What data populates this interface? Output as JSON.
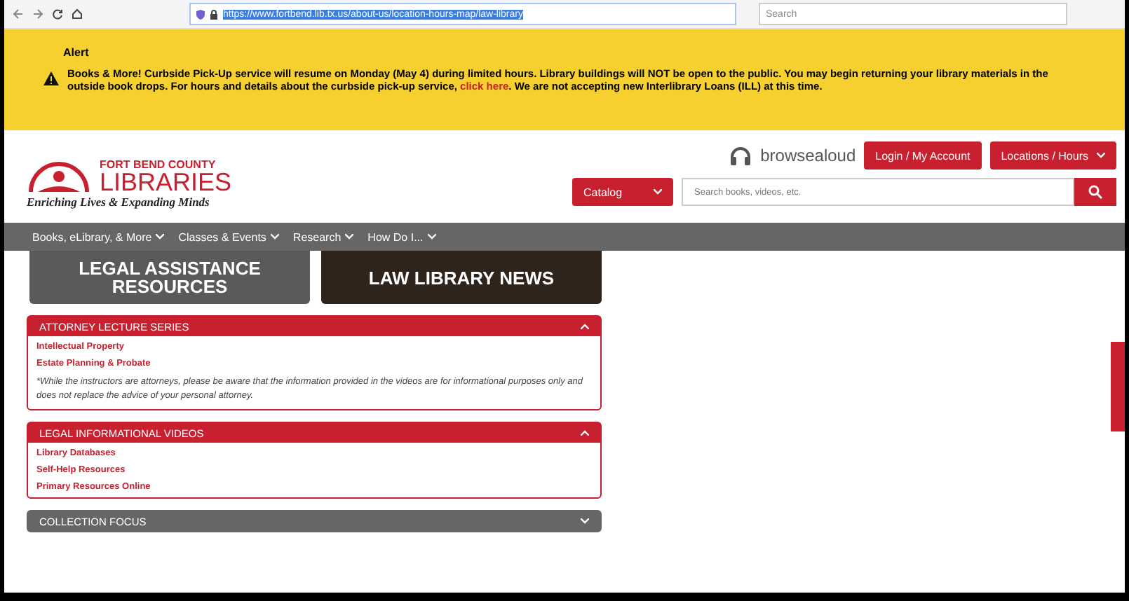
{
  "browser": {
    "url": "https://www.fortbend.lib.tx.us/about-us/location-hours-map/law-library",
    "search_placeholder": "Search"
  },
  "alert": {
    "title": "Alert",
    "text_before": "Books & More! Curbside Pick-Up service will resume on Monday (May 4) during limited hours. Library buildings will NOT be open to the public. You may begin returning your library materials in the outside book drops. For hours and details about the curbside pick-up service, ",
    "link": "click here",
    "text_after": ". We are not accepting new Interlibrary Loans (ILL) at this time."
  },
  "header": {
    "logo_top": "FORT BEND COUNTY",
    "logo_main": "LIBRARIES",
    "tagline": "Enriching Lives & Expanding Minds",
    "browsealoud": "browsealoud",
    "login": "Login / My Account",
    "locations": "Locations / Hours",
    "catalog": "Catalog",
    "search_placeholder": "Search books, videos, etc."
  },
  "nav": [
    {
      "label": "Books, eLibrary, & More"
    },
    {
      "label": "Classes & Events"
    },
    {
      "label": "Research"
    },
    {
      "label": "How Do I..."
    }
  ],
  "tiles": [
    {
      "title": "LEGAL ASSISTANCE RESOURCES"
    },
    {
      "title": "LAW LIBRARY NEWS"
    }
  ],
  "sections": [
    {
      "title": "ATTORNEY LECTURE SERIES",
      "expanded": true,
      "links": [
        "Intellectual Property",
        "Estate Planning & Probate"
      ],
      "note": "*While the instructors are attorneys, please be aware that the information provided in the videos are for informational purposes only and does not replace the advice of your personal attorney."
    },
    {
      "title": "LEGAL INFORMATIONAL VIDEOS",
      "expanded": true,
      "links": [
        "Library Databases",
        "Self-Help Resources",
        "Primary Resources Online"
      ]
    },
    {
      "title": "COLLECTION FOCUS",
      "expanded": false
    }
  ]
}
